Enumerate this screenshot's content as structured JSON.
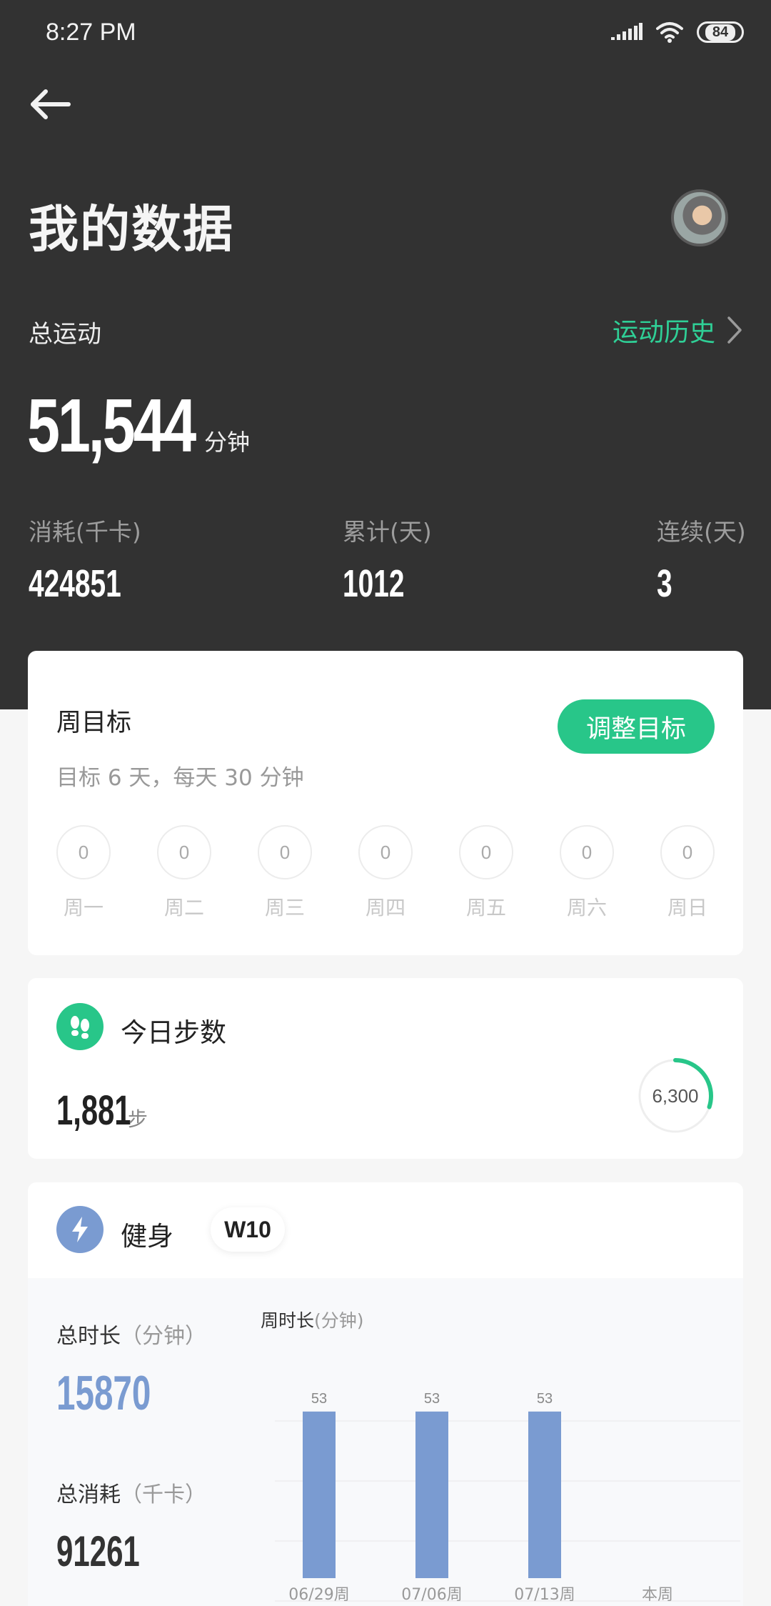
{
  "status_bar": {
    "time": "8:27 PM",
    "battery": "84"
  },
  "header": {
    "title": "我的数据"
  },
  "summary": {
    "total_label": "总运动",
    "history_link": "运动历史",
    "total_value": "51,544",
    "total_unit": "分钟",
    "stats": [
      {
        "label": "消耗(千卡)",
        "value": "424851"
      },
      {
        "label": "累计(天)",
        "value": "1012"
      },
      {
        "label": "连续(天)",
        "value": "3"
      }
    ]
  },
  "weekly_goal": {
    "title": "周目标",
    "adjust_button": "调整目标",
    "description": "目标 6 天，每天 30 分钟",
    "days": [
      {
        "label": "周一",
        "value": "0"
      },
      {
        "label": "周二",
        "value": "0"
      },
      {
        "label": "周三",
        "value": "0"
      },
      {
        "label": "周四",
        "value": "0"
      },
      {
        "label": "周五",
        "value": "0"
      },
      {
        "label": "周六",
        "value": "0"
      },
      {
        "label": "周日",
        "value": "0"
      }
    ]
  },
  "steps": {
    "title": "今日步数",
    "value": "1,881",
    "unit": "步",
    "goal": "6,300",
    "progress": 0.3
  },
  "fitness": {
    "title": "健身",
    "badge": "W10",
    "total_duration_label": "总时长",
    "total_duration_unit": "（分钟）",
    "total_duration": "15870",
    "total_calories_label": "总消耗",
    "total_calories_unit": "（千卡）",
    "total_calories": "91261",
    "chart_title": "周时长",
    "chart_unit": "(分钟)"
  },
  "chart_data": {
    "type": "bar",
    "categories": [
      "06/29周",
      "07/06周",
      "07/13周",
      "本周"
    ],
    "values": [
      53,
      53,
      53,
      0
    ],
    "value_labels": [
      "53",
      "53",
      "53",
      ""
    ],
    "color": "#7a9bd1",
    "ylim": [
      0,
      60
    ]
  },
  "colors": {
    "accent_green": "#28c689",
    "accent_blue": "#7a9bd1",
    "hero_bg": "#323232"
  }
}
